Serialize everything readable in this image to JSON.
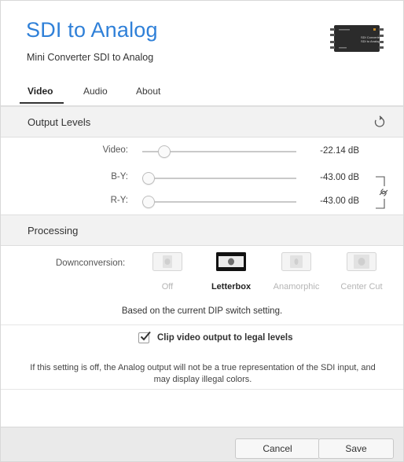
{
  "header": {
    "title": "SDI to Analog",
    "subtitle": "Mini Converter SDI to Analog",
    "device_label_line1": "SDI Converter",
    "device_label_line2": "SDI to Analog"
  },
  "tabs": [
    {
      "label": "Video",
      "active": true
    },
    {
      "label": "Audio",
      "active": false
    },
    {
      "label": "About",
      "active": false
    }
  ],
  "output_levels": {
    "title": "Output Levels",
    "rows": [
      {
        "label": "Video:",
        "value": "-22.14 dB",
        "fraction": 0.11
      },
      {
        "label": "B-Y:",
        "value": "-43.00 dB",
        "fraction": 0.0
      },
      {
        "label": "R-Y:",
        "value": "-43.00 dB",
        "fraction": 0.0
      }
    ]
  },
  "processing": {
    "title": "Processing",
    "downconversion_label": "Downconversion:",
    "modes": [
      {
        "label": "Off",
        "active": false
      },
      {
        "label": "Letterbox",
        "active": true
      },
      {
        "label": "Anamorphic",
        "active": false
      },
      {
        "label": "Center Cut",
        "active": false
      }
    ],
    "dip_note": "Based on the current DIP switch setting.",
    "clip_checkbox": {
      "label": "Clip video output to legal levels",
      "checked": true
    },
    "legal_note": "If this setting is off, the Analog output will not be a true representation of the SDI input, and may display illegal colors."
  },
  "footer": {
    "cancel_label": "Cancel",
    "save_label": "Save"
  },
  "colors": {
    "accent": "#2f80d8",
    "section_bg": "#f2f2f2",
    "footer_bg": "#eaeaea"
  }
}
